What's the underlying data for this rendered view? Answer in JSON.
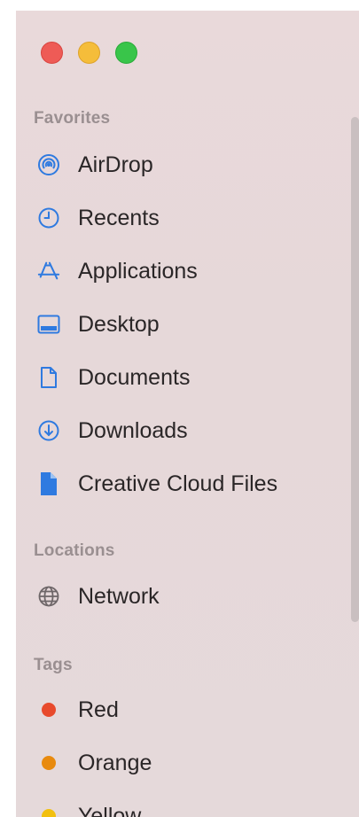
{
  "sections": {
    "favorites": "Favorites",
    "locations": "Locations",
    "tags": "Tags"
  },
  "favorites": [
    {
      "label": "AirDrop",
      "icon": "airdrop-icon"
    },
    {
      "label": "Recents",
      "icon": "clock-icon"
    },
    {
      "label": "Applications",
      "icon": "applications-icon"
    },
    {
      "label": "Desktop",
      "icon": "desktop-icon"
    },
    {
      "label": "Documents",
      "icon": "document-icon"
    },
    {
      "label": "Downloads",
      "icon": "download-icon"
    },
    {
      "label": "Creative Cloud Files",
      "icon": "creative-cloud-file-icon"
    }
  ],
  "locations": [
    {
      "label": "Network",
      "icon": "network-globe-icon"
    }
  ],
  "tags": [
    {
      "label": "Red",
      "color": "#e84a2c"
    },
    {
      "label": "Orange",
      "color": "#e88a0e"
    },
    {
      "label": "Yellow",
      "color": "#f2c00f"
    }
  ],
  "colors": {
    "accent": "#2f7ae0",
    "window_close": "#ee5b56",
    "window_minimize": "#f5bd3a",
    "window_zoom": "#39c54a"
  }
}
